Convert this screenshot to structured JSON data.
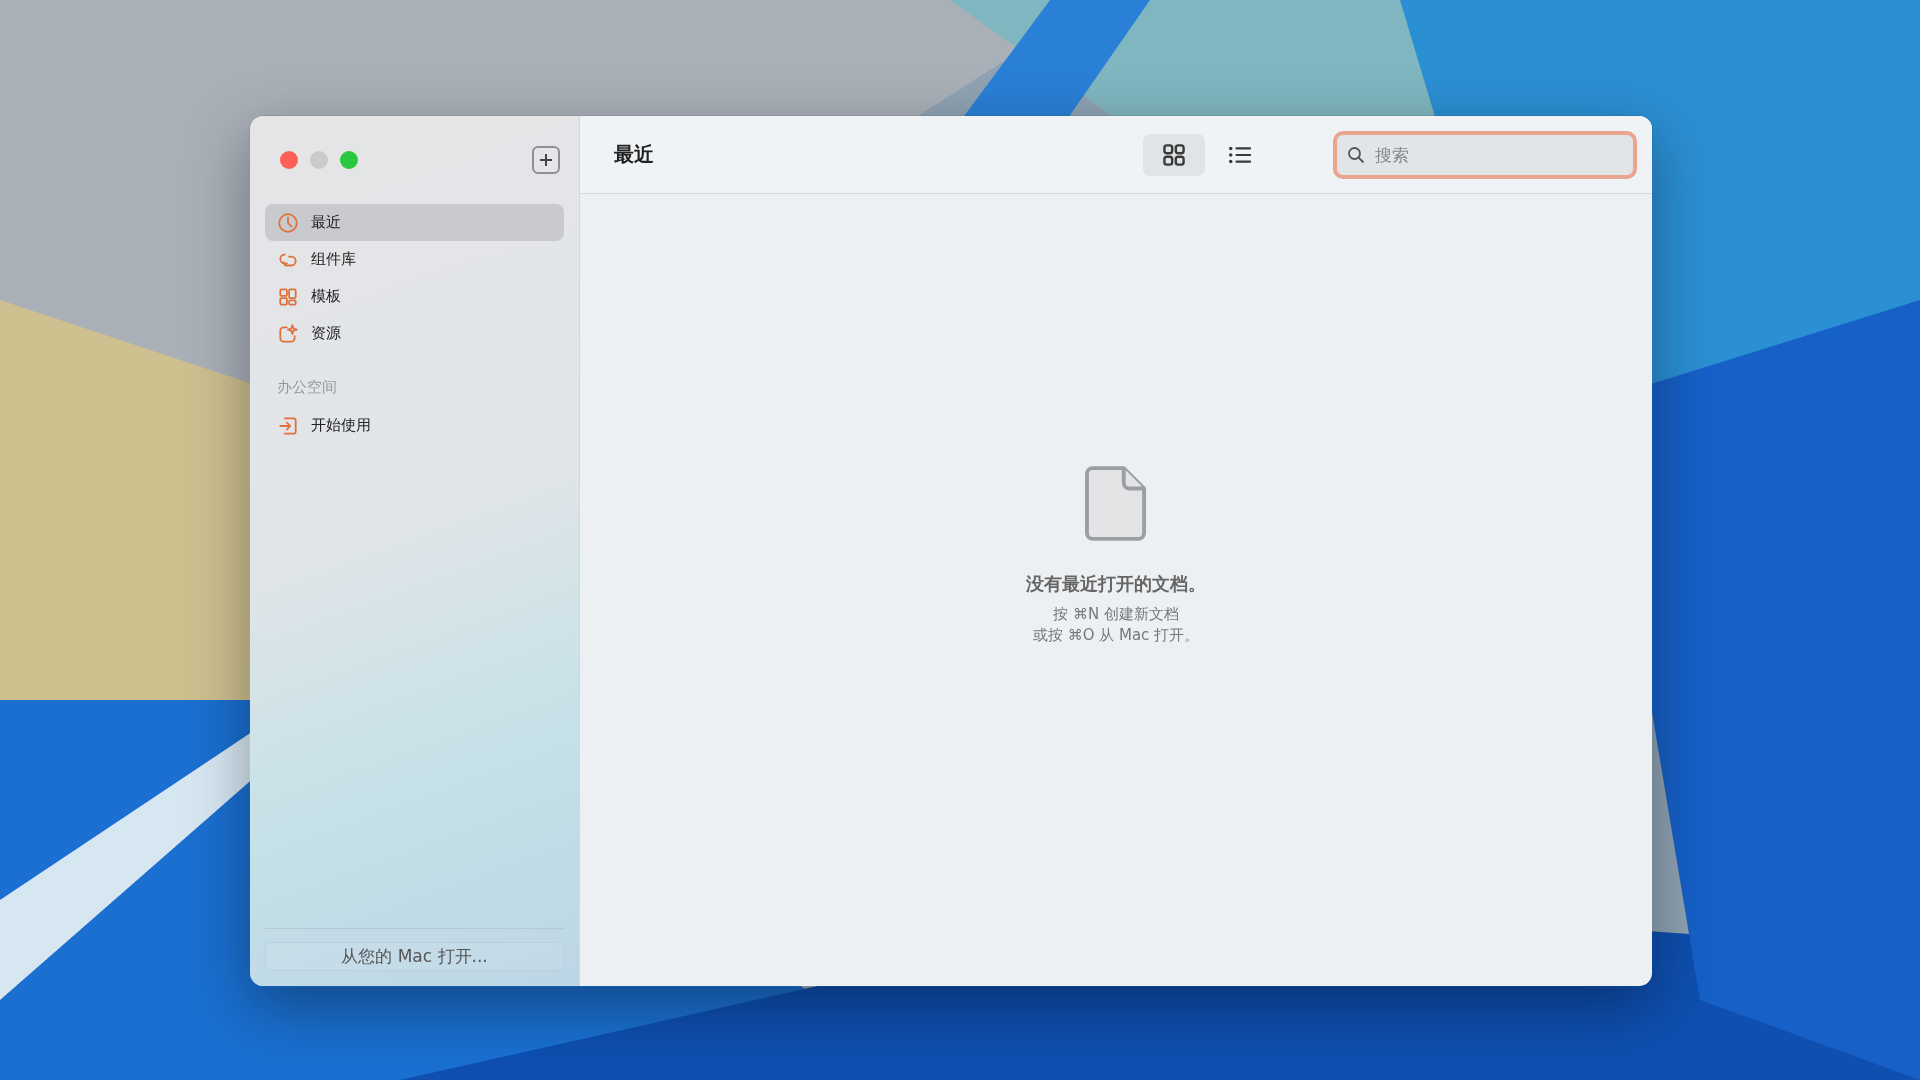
{
  "sidebar": {
    "items": [
      {
        "kind": "clock",
        "label": "最近",
        "selected": true
      },
      {
        "kind": "links",
        "label": "组件库",
        "selected": false
      },
      {
        "kind": "grid",
        "label": "模板",
        "selected": false
      },
      {
        "kind": "sparkle",
        "label": "资源",
        "selected": false
      }
    ],
    "section": {
      "heading": "办公空间",
      "items": [
        {
          "kind": "enter",
          "label": "开始使用",
          "selected": false
        }
      ]
    },
    "open_button": "从您的 Mac 打开..."
  },
  "toolbar": {
    "title": "最近",
    "views": [
      {
        "kind": "grid",
        "selected": true
      },
      {
        "kind": "list",
        "selected": false
      }
    ],
    "search": {
      "placeholder": "搜索"
    }
  },
  "empty_state": {
    "title": "没有最近打开的文档。",
    "lines": [
      "按 ⌘N 创建新文档",
      "或按 ⌘O 从 Mac 打开。"
    ]
  }
}
